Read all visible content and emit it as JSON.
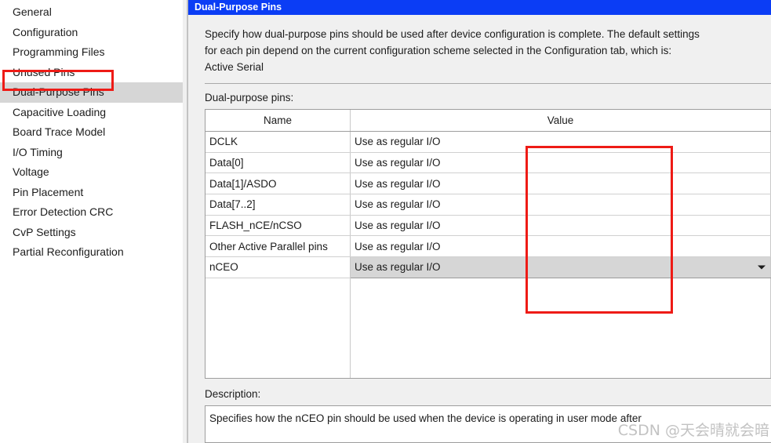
{
  "sidebar": {
    "items": [
      {
        "label": "General",
        "selected": false
      },
      {
        "label": "Configuration",
        "selected": false
      },
      {
        "label": "Programming Files",
        "selected": false
      },
      {
        "label": "Unused Pins",
        "selected": false
      },
      {
        "label": "Dual-Purpose Pins",
        "selected": true
      },
      {
        "label": "Capacitive Loading",
        "selected": false
      },
      {
        "label": "Board Trace Model",
        "selected": false
      },
      {
        "label": "I/O Timing",
        "selected": false
      },
      {
        "label": "Voltage",
        "selected": false
      },
      {
        "label": "Pin Placement",
        "selected": false
      },
      {
        "label": "Error Detection CRC",
        "selected": false
      },
      {
        "label": "CvP Settings",
        "selected": false
      },
      {
        "label": "Partial Reconfiguration",
        "selected": false
      }
    ]
  },
  "panel": {
    "title": "Dual-Purpose Pins",
    "intro_line1": "Specify how dual-purpose pins should be used after device configuration is complete. The default settings",
    "intro_line2": "for each pin depend on the current configuration scheme selected in the Configuration tab, which is:",
    "intro_line3": "Active Serial",
    "section_label": "Dual-purpose pins:",
    "table": {
      "columns": [
        "Name",
        "Value"
      ],
      "rows": [
        {
          "name": "DCLK",
          "value": "Use as regular I/O",
          "selected": false
        },
        {
          "name": "Data[0]",
          "value": "Use as regular I/O",
          "selected": false
        },
        {
          "name": "Data[1]/ASDO",
          "value": "Use as regular I/O",
          "selected": false
        },
        {
          "name": "Data[7..2]",
          "value": "Use as regular I/O",
          "selected": false
        },
        {
          "name": "FLASH_nCE/nCSO",
          "value": "Use as regular I/O",
          "selected": false
        },
        {
          "name": "Other Active Parallel pins",
          "value": "Use as regular I/O",
          "selected": false
        },
        {
          "name": "nCEO",
          "value": "Use as regular I/O",
          "selected": true
        }
      ]
    },
    "description_label": "Description:",
    "description_text": "Specifies how the nCEO pin should be used when the device is operating in user mode after"
  },
  "annotations": {
    "sidebar_highlight_color": "#ee1b16",
    "value_column_highlight_color": "#ee1b16"
  },
  "watermark": {
    "text": "CSDN @天会晴就会暗"
  },
  "colors": {
    "title_bar": "#0b3df5",
    "selection": "#d6d6d6",
    "panel_background": "#f0f0f0"
  }
}
